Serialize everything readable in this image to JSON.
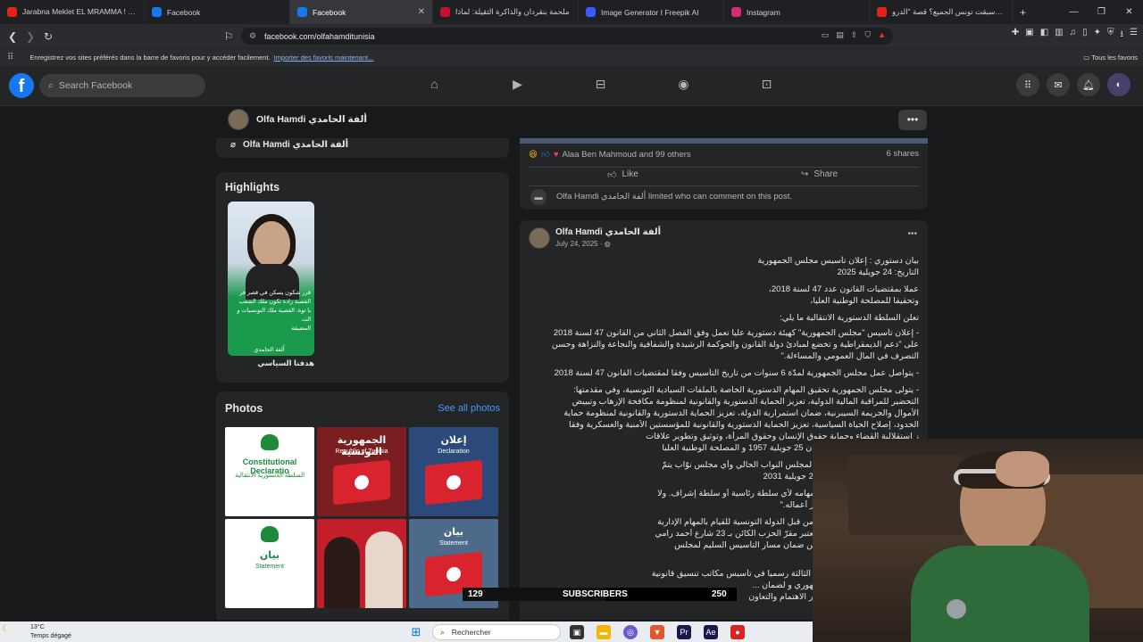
{
  "browser": {
    "tabs": [
      {
        "title": "Jarabna Meklet EL MRAMMA ! 😁 -",
        "color": "#e62117",
        "active": false
      },
      {
        "title": "Facebook",
        "color": "#1877f2",
        "active": false
      },
      {
        "title": "Facebook",
        "color": "#1877f2",
        "active": true
      },
      {
        "title": "ملحمة بنقردان والذاكرة الثقيلة: لماذا",
        "color": "#c8102e",
        "active": false
      },
      {
        "title": "Image Generator I Freepik AI",
        "color": "#3a5bff",
        "active": false
      },
      {
        "title": "Instagram",
        "color": "#d62976",
        "active": false
      },
      {
        "title": "كيف سبقت تونس الجميع؟ قصة \"الدرو",
        "color": "#e62117",
        "active": false
      }
    ],
    "new_tab": "+",
    "close": "✕",
    "url": "facebook.com/olfahamditunisia",
    "bookmarks_text": "Enregistrez vos sites préférés dans la barre de favoris pour y accéder facilement.",
    "bookmarks_link": "Importer des favoris maintenant...",
    "all_favorites": "Tous les favoris"
  },
  "fb": {
    "search_placeholder": "Search Facebook",
    "profile_name": "Olfa Hamdi ألفة الحامدي",
    "messenger_name": "Olfa Hamdi ألفة الحامدي",
    "highlights_title": "Highlights",
    "highlight_caption": "هدفنا السياسي",
    "highlight_text_lines": [
      "قرر شكون يسكن في قصر قر",
      "القصبة زادة تكون ملك الشعب",
      "يا توة، القصبة ملك التونسيات و الت",
      "المضيقة",
      "أَلفة الحامدي"
    ],
    "photos_title": "Photos",
    "see_all": "See all photos",
    "photos": [
      {
        "title": "Constitutional Declaratio",
        "sub": "السلطة الدستورية الانتقالية",
        "bg": "#ffffff",
        "fg": "#1d8a3a"
      },
      {
        "title": "الجمهورية التونسية",
        "sub": "Republic of Tunisia",
        "bg": "#7a1e22",
        "fg": "#ffffff"
      },
      {
        "title": "إعلان",
        "sub": "Declaration",
        "bg": "#2b4a7a",
        "fg": "#ffffff"
      },
      {
        "title": "بيان",
        "sub": "Statement",
        "bg": "#ffffff",
        "fg": "#1d8a3a"
      },
      {
        "title": "",
        "sub": "",
        "bg": "#c41e2a",
        "fg": "#ffffff"
      },
      {
        "title": "بيان",
        "sub": "Statement",
        "bg": "#4d6a8a",
        "fg": "#ffffff"
      }
    ]
  },
  "post_prev": {
    "reactions": "Alaa Ben Mahmoud and 99 others",
    "shares": "6 shares",
    "like": "Like",
    "share": "Share",
    "limited": "Olfa Hamdi ألفة الحامدي limited who can comment on this post."
  },
  "post": {
    "author": "Olfa Hamdi ألفة الحامدي",
    "date": "July 24, 2025 · ",
    "lines": [
      "بيان دستوري : إعلان تأسيس مجلس الجمهورية",
      "التاريخ: 24 جويلية 2025",
      "عملا بمقتضيات القانون عدد 47 لسنة 2018،",
      "وتحقيقا للمصلحة الوطنية العليا،",
      "تعلن السلطة الدستورية الانتقالية ما يلي:",
      "- إعلان تأسيس \"مجلس الجمهورية\" كهيئة دستورية عليا تعمل وفق الفصل الثاني من القانون 47 لسنة 2018",
      "على \"دعم الديمقراطية و تخضع لمبادئ دولة القانون والحوكمة الرشيدة والشفافية والنجاعة والنزاهة وحسن",
      "التصرف في المال العمومي والمساءلة.\"",
      "- يتواصل عمل مجلس الجمهورية لمدّة 6 سنوات من تاريخ التأسيس وفقا لمقتضيات القانون 47 لسنة 2018",
      "- يتولى مجلس الجمهورية تحقيق المهام الدستورية الخاصة بالملفات السيادية التونسية، وفي مقدمتها:",
      "التحضير للمراقبة المالية الدولية، تعزيز الحماية الدستورية والقانونية لمنظومة مكافحة الإرهاب وتبييض",
      "الأموال والجريمة السيبرنية، ضمان استمرارية الدولة، تعزيز الحماية الدستورية والقانونية لمنظومة حماية",
      "الحدود، إصلاح الحياة السياسية، تعزيز الحماية الدستورية والقانونية للمؤسستين الأمنية والعسكرية وفقا",
      "ز استقلالية القضاء وحماية حقوق الإنسان وحقوق المرأة، وتوثيق وتطوير علاقات",
      "ثوابت الجمهورية التونسية وإعلان 25 جويلية 1957 و المصلحة الوطنية العليا",
      "ة دستورية عليا تقريره السنوي لمجلس النواب الحالي وأي مجلس نوّاب يتمّ",
      "ممتدة بين 25 جويلية 2025 و 25 جويلية 2031",
      "لا يخضع المجلس في ممارسة مهامه لأي سلطة رئاسية أو سلطة إشراف. ولا",
      "تدخل من أي جهة كانت في سير أعماله.\"",
      "لجمهورية الثالثة و المرخّص له من قبل الدولة التونسية للقيام بالمهام الإدارية",
      "ي القسم الثاني من القانون، ويعتبر مقرّ الحزب الكائن بـ 23 شارع أحمد رامي",
      "لدستورية الانتقالية المسؤولة عن ضمان مسار التأسيس السليم لمجلس",
      "نقالية و رئاسة حزب الجمهورية الثالثة رسميا في تأسيس مكاتب تنسيق قانونية",
      "س لضمان استمرارية ا  ... الجمهوري و لضمان ...",
      "ل و كل المجالات السيادية محور الاهتمام والتعاون"
    ]
  },
  "overlay": {
    "subs_count": "129",
    "subs_label": "SUBSCRIBERS",
    "subs_goal": "250"
  },
  "taskbar": {
    "temp": "13°C",
    "weather": "Temps dégagé",
    "search": "Rechercher"
  }
}
